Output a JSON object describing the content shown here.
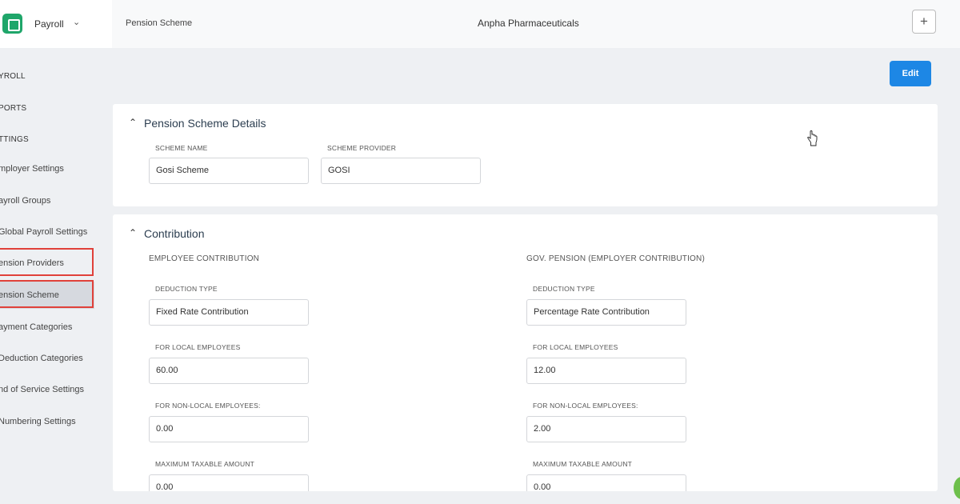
{
  "app": {
    "module_label": "Payroll"
  },
  "topbar": {
    "breadcrumb": "Pension Scheme",
    "company": "Anpha Pharmaceuticals",
    "plus_label": "+"
  },
  "toolbar": {
    "edit_label": "Edit"
  },
  "sidebar": {
    "items": [
      {
        "label": "YROLL"
      },
      {
        "label": "PORTS"
      },
      {
        "label": "TTINGS"
      },
      {
        "label": "mployer Settings"
      },
      {
        "label": "ayroll Groups"
      },
      {
        "label": "Global Payroll Settings"
      },
      {
        "label": "ension Providers"
      },
      {
        "label": "ension Scheme"
      },
      {
        "label": "ayment Categories"
      },
      {
        "label": "Deduction Categories"
      },
      {
        "label": "nd of Service Settings"
      },
      {
        "label": "Numbering Settings"
      }
    ]
  },
  "details": {
    "title": "Pension Scheme Details",
    "scheme_name_label": "SCHEME NAME",
    "scheme_name_value": "Gosi Scheme",
    "scheme_provider_label": "SCHEME PROVIDER",
    "scheme_provider_value": "GOSI"
  },
  "contribution": {
    "title": "Contribution",
    "employee": {
      "heading": "EMPLOYEE CONTRIBUTION",
      "deduction_type_label": "DEDUCTION TYPE",
      "deduction_type_value": "Fixed Rate Contribution",
      "local_label": "FOR LOCAL EMPLOYEES",
      "local_value": "60.00",
      "nonlocal_label": "FOR NON-LOCAL EMPLOYEES:",
      "nonlocal_value": "0.00",
      "max_taxable_label": "MAXIMUM TAXABLE AMOUNT",
      "max_taxable_value": "0.00"
    },
    "employer": {
      "heading": "GOV. PENSION (EMPLOYER CONTRIBUTION)",
      "deduction_type_label": "DEDUCTION TYPE",
      "deduction_type_value": "Percentage Rate Contribution",
      "local_label": "FOR LOCAL EMPLOYEES",
      "local_value": "12.00",
      "nonlocal_label": "FOR NON-LOCAL EMPLOYEES:",
      "nonlocal_value": "2.00",
      "max_taxable_label": "MAXIMUM TAXABLE AMOUNT",
      "max_taxable_value": "0.00"
    }
  },
  "colors": {
    "accent": "#1d87e5",
    "brand": "#1fa66a",
    "highlight": "#e0413a"
  },
  "icons": {
    "logo": "wallet-logo-icon",
    "chevron": "chevron-down-icon",
    "collapse": "chevron-up-icon",
    "cursor": "hand-pointer-icon"
  }
}
